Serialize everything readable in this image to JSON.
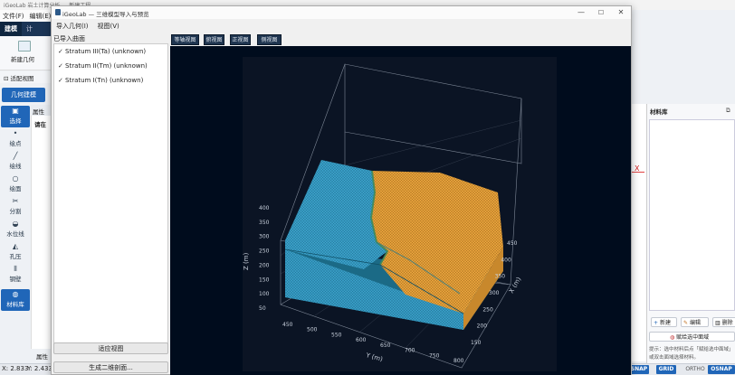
{
  "main_window": {
    "title": "iGeoLab 岩土计算分析 — 新建工程",
    "menu": [
      "文件(F)",
      "编辑(E)"
    ],
    "ribbon_tabs": [
      {
        "label": "建模",
        "active": true
      },
      {
        "label": "计"
      }
    ],
    "ribbon_new_geometry": "新建几何",
    "view_bar_label": "适配视图",
    "geometry_mode_button": "几何建模",
    "tools": [
      {
        "label": "选择",
        "icon": "select-icon",
        "glyph": "▣",
        "selected": true
      },
      {
        "label": "绘点",
        "icon": "point-icon",
        "glyph": "•",
        "selected": false
      },
      {
        "label": "绘线",
        "icon": "line-icon",
        "glyph": "╱",
        "selected": false
      },
      {
        "label": "绘面",
        "icon": "polygon-icon",
        "glyph": "○",
        "selected": false
      },
      {
        "label": "分割",
        "icon": "scissors-icon",
        "glyph": "✂",
        "selected": false
      },
      {
        "label": "水位线",
        "icon": "water-icon",
        "glyph": "◒",
        "selected": false
      },
      {
        "label": "孔压",
        "icon": "pressure-icon",
        "glyph": "◭",
        "selected": false
      },
      {
        "label": "钢壁",
        "icon": "wall-icon",
        "glyph": "⦀",
        "selected": false
      },
      {
        "label": "材料库",
        "icon": "materials-icon",
        "glyph": "◍",
        "selected": true
      }
    ],
    "props_tab": "属性",
    "props_hint": "请在",
    "props_bottom_tab": "属性",
    "status": {
      "x": "X: 2.833",
      "y": "Y: 2.433"
    },
    "snap_buttons": [
      "SNAP",
      "GRID",
      "ORTHO",
      "OSNAP"
    ],
    "x_axis_marker": "X",
    "materials": {
      "title": "材料库",
      "new": "新建",
      "edit": "编辑",
      "delete": "删除",
      "assign_button": "赋给选中面域",
      "tip_line1": "提示：选中材料后点「赋给选中面域」",
      "tip_line2": "或双击面域选择材料。"
    }
  },
  "dialog": {
    "title": "iGeoLab — 三维模型导入与预览",
    "menu": [
      "导入几何(I)",
      "视图(V)"
    ],
    "imported_label": "已导入曲面",
    "layers": [
      {
        "name": "Stratum III(Ta)  (unknown)",
        "checked": true
      },
      {
        "name": "Stratum II(Tm)  (unknown)",
        "checked": true
      },
      {
        "name": "Stratum I(Tn)  (unknown)",
        "checked": true
      }
    ],
    "fit_view_button": "适应视图",
    "generate_2d_button": "生成二维剖面...",
    "view_buttons": [
      "等轴视图",
      "俯视图",
      "正视图",
      "侧视图"
    ],
    "window_controls": {
      "minimize": "—",
      "maximize": "☐",
      "close": "✕"
    }
  },
  "chart_data": {
    "type": "3d-surface",
    "title": "",
    "xlabel": "X (m)",
    "ylabel": "Y (m)",
    "zlabel": "Z (m)",
    "x_ticks": [
      150,
      200,
      250,
      300,
      350,
      400,
      450
    ],
    "y_ticks": [
      450,
      500,
      550,
      600,
      650,
      700,
      750,
      800
    ],
    "z_ticks": [
      50,
      100,
      150,
      200,
      250,
      300,
      350,
      400
    ],
    "colors": {
      "stratum_a": "#e8a23c",
      "stratum_b": "#3aa0c8",
      "background": "#0b1424"
    }
  }
}
